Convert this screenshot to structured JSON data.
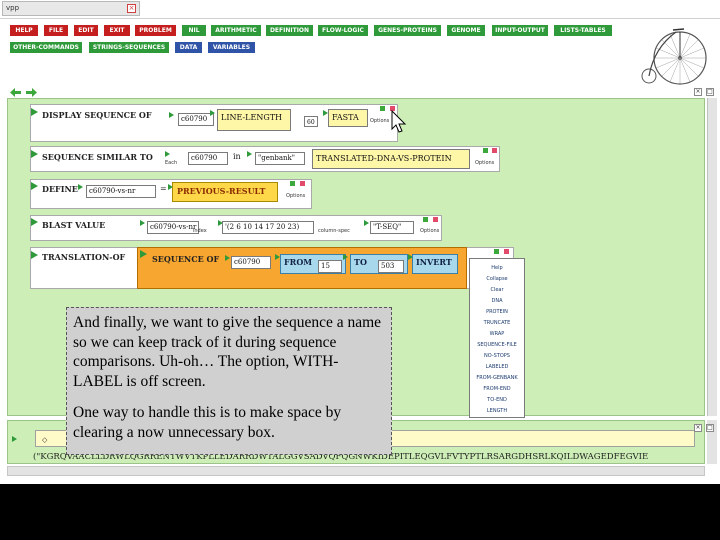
{
  "window": {
    "title": "vpp"
  },
  "menu": {
    "row1": [
      {
        "label": "HELP",
        "color": "red"
      },
      {
        "label": "FILE",
        "color": "red"
      },
      {
        "label": "EDIT",
        "color": "red"
      },
      {
        "label": "EXIT",
        "color": "red"
      },
      {
        "label": "PROBLEM",
        "color": "red"
      },
      {
        "label": "NIL",
        "color": "green"
      },
      {
        "label": "ARITHMETIC",
        "color": "green"
      },
      {
        "label": "DEFINITION",
        "color": "green"
      },
      {
        "label": "FLOW-LOGIC",
        "color": "green"
      },
      {
        "label": "GENES-PROTEINS",
        "color": "green"
      },
      {
        "label": "GENOME",
        "color": "green"
      },
      {
        "label": "INPUT-OUTPUT",
        "color": "green"
      },
      {
        "label": "LISTS-TABLES",
        "color": "green"
      }
    ],
    "row2": [
      {
        "label": "OTHER-COMMANDS",
        "color": "green"
      },
      {
        "label": "STRINGS-SEQUENCES",
        "color": "green"
      },
      {
        "label": "DATA",
        "color": "blue"
      },
      {
        "label": "VARIABLES",
        "color": "blue"
      }
    ]
  },
  "commands": {
    "display": {
      "name": "DISPLAY SEQUENCE OF",
      "arg1": "c60790",
      "arg2": "LINE-LENGTH",
      "arg3": "60",
      "arg4": "FASTA",
      "options": "Options"
    },
    "similar": {
      "name": "SEQUENCE SIMILAR TO",
      "tag1": "Each",
      "arg1": "c60790",
      "in": "in",
      "arg2": "\"genbank\"",
      "arg3": "TRANSLATED-DNA-VS-PROTEIN",
      "options": "Options"
    },
    "define": {
      "name": "DEFINE",
      "arg1": "c60790-vs-nr",
      "eq": "=",
      "arg2": "PREVIOUS-RESULT",
      "options": "Options"
    },
    "blast": {
      "name": "BLAST VALUE",
      "arg1": "c60790-vs-nr",
      "tag1": "index",
      "arg2": "'(2 6 10 14 17 20 23)",
      "tag2": "column-spec",
      "arg3": "\"T-SEQ\"",
      "options": "Options"
    },
    "translation": {
      "name": "TRANSLATION-OF",
      "seq": "SEQUENCE OF",
      "arg1": "c60790",
      "from": "FROM",
      "from_val": "15",
      "to": "TO",
      "to_val": "503",
      "invert": "INVERT"
    }
  },
  "popup_menu": {
    "items": [
      "Help",
      "Collapse",
      "Clear",
      "DNA",
      "PROTEIN",
      "TRUNCATE",
      "WRAP",
      "SEQUENCE-FILE",
      "NO-STOPS",
      "LABELED",
      "FROM-GENBANK",
      "FROM-END",
      "TO-END",
      "LENGTH"
    ]
  },
  "annotation": {
    "paragraph1": "And finally, we want to give the sequence a name so we can keep track of it during sequence comparisons. Uh-oh… The option, WITH-LABEL is off screen.",
    "paragraph2": "One way to handle this is to make space by clearing a now unnecessary box."
  },
  "result": {
    "sequence": "(\"KGRQVAACLLDRWLQGRRENTWVTKPLLEDARRDWTALGGVSADVQFQGNWKIDEPITLEQGVLFVTYPTLRSARGDHSRLKQILDWAGEDFEGVIE"
  }
}
